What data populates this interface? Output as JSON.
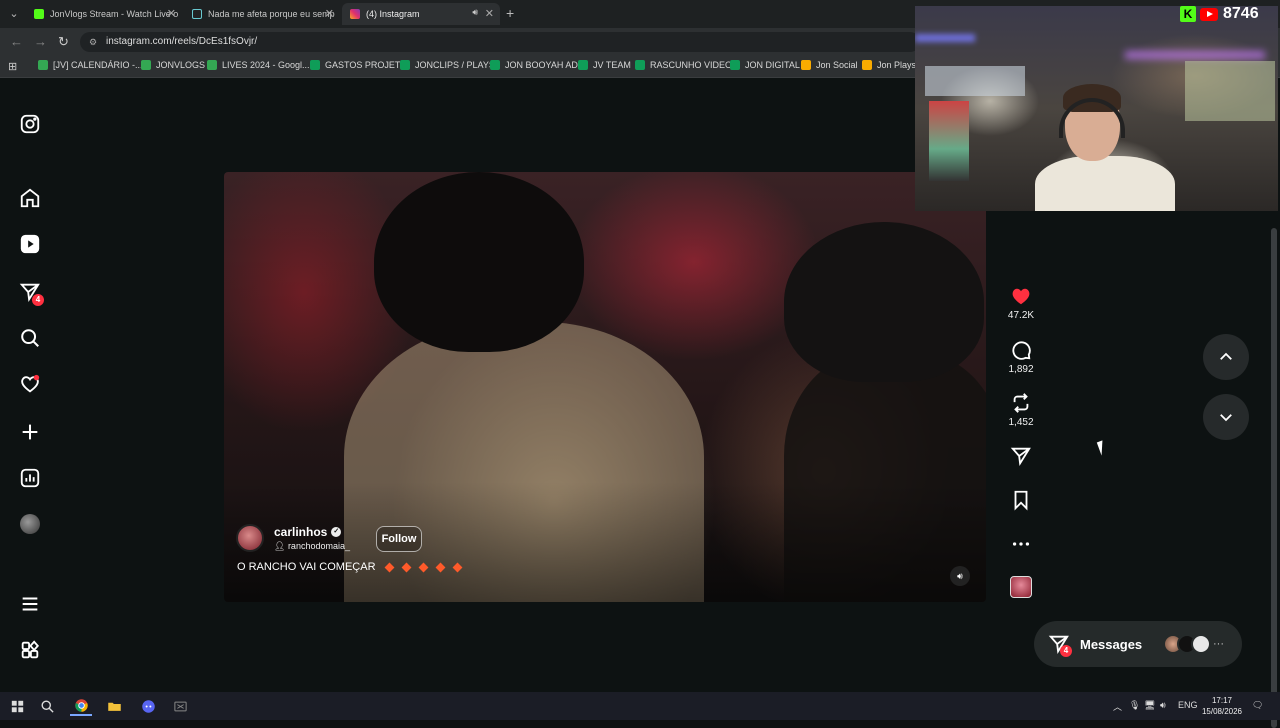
{
  "browser": {
    "tabs": [
      {
        "title": "JonVlogs Stream - Watch Live o",
        "favicon_color": "#53fc18"
      },
      {
        "title": "Nada me afeta porque eu semp",
        "favicon_color": "#111111"
      },
      {
        "title": "(4) Instagram",
        "favicon_color": "#e1306c"
      }
    ],
    "new_tab": "+",
    "url": "instagram.com/reels/DcEs1fsOvjr/",
    "bookmarks": [
      {
        "label": "[JV] CALENDÁRIO -...",
        "color": "#34a853"
      },
      {
        "label": "JONVLOGS",
        "color": "#34a853"
      },
      {
        "label": "LIVES 2024 - Googl...",
        "color": "#34a853"
      },
      {
        "label": "GASTOS PROJETO",
        "color": "#0f9d58"
      },
      {
        "label": "JONCLIPS / PLAYS",
        "color": "#0f9d58"
      },
      {
        "label": "JON BOOYAH AD",
        "color": "#0f9d58"
      },
      {
        "label": "JV TEAM",
        "color": "#0f9d58"
      },
      {
        "label": "RASCUNHO VIDEO",
        "color": "#0f9d58"
      },
      {
        "label": "JON DIGITAL",
        "color": "#0f9d58"
      },
      {
        "label": "Jon Social",
        "color": "#f9ab00"
      },
      {
        "label": "Jon Plays",
        "color": "#f9ab00"
      }
    ]
  },
  "sidebar": {
    "notifications_badge": "4",
    "items": [
      "instagram-logo-icon",
      "home-icon",
      "reels-icon",
      "messages-icon",
      "search-icon",
      "notifications-icon",
      "create-icon",
      "dashboard-icon",
      "profile-avatar",
      "more-menu-icon",
      "also-from-meta-icon"
    ]
  },
  "reel": {
    "username": "carlinhos",
    "collaborator": "ranchodomaia_",
    "follow_label": "Follow",
    "caption": "O RANCHO VAI COMEÇAR",
    "caption_emoji_count": 5
  },
  "actions": {
    "likes": "47.2K",
    "comments": "1,892",
    "reposts": "1,452",
    "liked_color": "#ff3040"
  },
  "messages": {
    "label": "Messages",
    "badge": "4"
  },
  "stream_overlay": {
    "viewer_count": "8746"
  },
  "taskbar": {
    "language": "ENG",
    "time": "17:17",
    "date": "15/08/2026"
  },
  "colors": {
    "accent_red": "#ff3040",
    "background": "#0d1212"
  }
}
